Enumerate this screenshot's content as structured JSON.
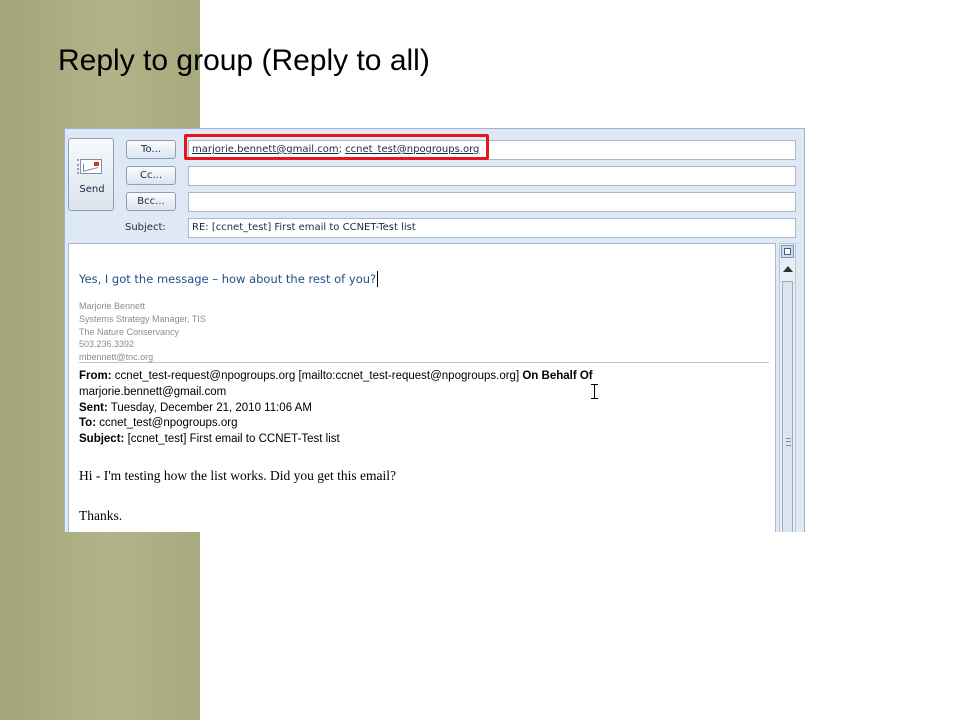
{
  "slide": {
    "title": "Reply to group (Reply to all)"
  },
  "compose": {
    "send_label": "Send",
    "to_button": "To...",
    "cc_button": "Cc...",
    "bcc_button": "Bcc...",
    "subject_label": "Subject:",
    "to_recipients": [
      "marjorie.bennett@gmail.com",
      "ccnet_test@npogroups.org"
    ],
    "to_separator": ";",
    "cc_value": "",
    "bcc_value": "",
    "subject_value": "RE: [ccnet_test] First email to CCNET-Test list"
  },
  "body": {
    "reply_text": "Yes, I got the message – how about the rest of you?",
    "signature": [
      "Marjorie Bennett",
      "Systems Strategy Manager, TIS",
      "The Nature Conservancy",
      "503.236.3392",
      "mbennett@tnc.org"
    ],
    "quoted_header": {
      "from_label": "From:",
      "from_value": "ccnet_test-request@npogroups.org [mailto:ccnet_test-request@npogroups.org]",
      "behalf_label": "On Behalf Of",
      "behalf_value": "marjorie.bennett@gmail.com",
      "sent_label": "Sent:",
      "sent_value": "Tuesday, December 21, 2010 11:06 AM",
      "to_label": "To:",
      "to_value": "ccnet_test@npogroups.org",
      "subject_label": "Subject:",
      "subject_value": "[ccnet_test] First email to CCNET-Test list"
    },
    "message_lines": [
      "Hi - I'm testing how the list works. Did you get this email?",
      "Thanks."
    ]
  },
  "colors": {
    "highlight": "#e8141b",
    "reply_text": "#1f4e8a",
    "side_band": "#a9ab7f"
  }
}
